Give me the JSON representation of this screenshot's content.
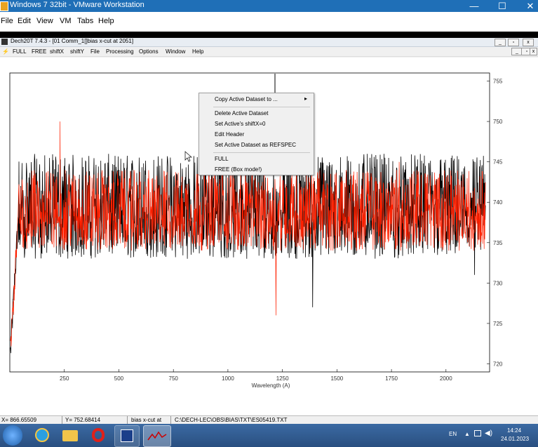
{
  "host": {
    "title": "Windows 7 32bit - VMware Workstation",
    "menu": [
      "File",
      "Edit",
      "View",
      "VM",
      "Tabs",
      "Help"
    ],
    "controls": {
      "minimize": "—",
      "maximize": "☐",
      "close": "✕"
    }
  },
  "app": {
    "title": "Dech20T 7.4.3 - [01 Comm_1[]bias  x-cut at        2051]",
    "menu": [
      "FULL",
      "FREE",
      "shiftX",
      "shiftY",
      "File",
      "Processing",
      "Options",
      "Window",
      "Help"
    ]
  },
  "context_menu": {
    "items": [
      "Copy Active Dataset to ...",
      "Delete Active Dataset",
      "Set Active's shiftX=0",
      "Edit Header",
      "Set Active Dataset as REFSPEC",
      "FULL",
      "FREE (Box mode!)"
    ],
    "submenu_arrow": "▸"
  },
  "chart_data": {
    "type": "line",
    "xlabel": "Wavelength (A)",
    "ylabel": "",
    "xlim": [
      0,
      2200
    ],
    "ylim": [
      719,
      756
    ],
    "x_ticks": [
      "250",
      "500",
      "750",
      "1000",
      "1250",
      "1500",
      "1750",
      "2000"
    ],
    "y_ticks": [
      "720",
      "725",
      "730",
      "735",
      "740",
      "745",
      "750",
      "755"
    ],
    "series": [
      {
        "color": "#000000",
        "mean": 738.5,
        "noise_band": [
          733,
          746
        ],
        "spikes": [
          [
            1090,
            749
          ],
          [
            1400,
            727
          ],
          [
            2150,
            731
          ]
        ]
      },
      {
        "color": "#ff2000",
        "mean": 738.5,
        "noise_band": [
          734,
          744
        ],
        "spikes": [
          [
            230,
            750
          ],
          [
            1230,
            726
          ],
          [
            1800,
            745
          ]
        ]
      }
    ],
    "colors": {
      "series_black": "#000000",
      "series_red": "#ff2000"
    }
  },
  "status": {
    "x_readout": "X= 866.65509",
    "y_readout": "Y= 752.68414",
    "dataset": "bias  x-cut at",
    "path": "C:\\DECH-LEC\\OBS\\BIAS\\TXT\\ES05419.TXT"
  },
  "taskbar": {
    "apps": [
      "start-orb",
      "ie-icon",
      "explorer-icon",
      "opera-icon",
      "save-icon",
      "dech-icon"
    ],
    "language": "EN",
    "time": "14:24",
    "date": "24.01.2023"
  }
}
